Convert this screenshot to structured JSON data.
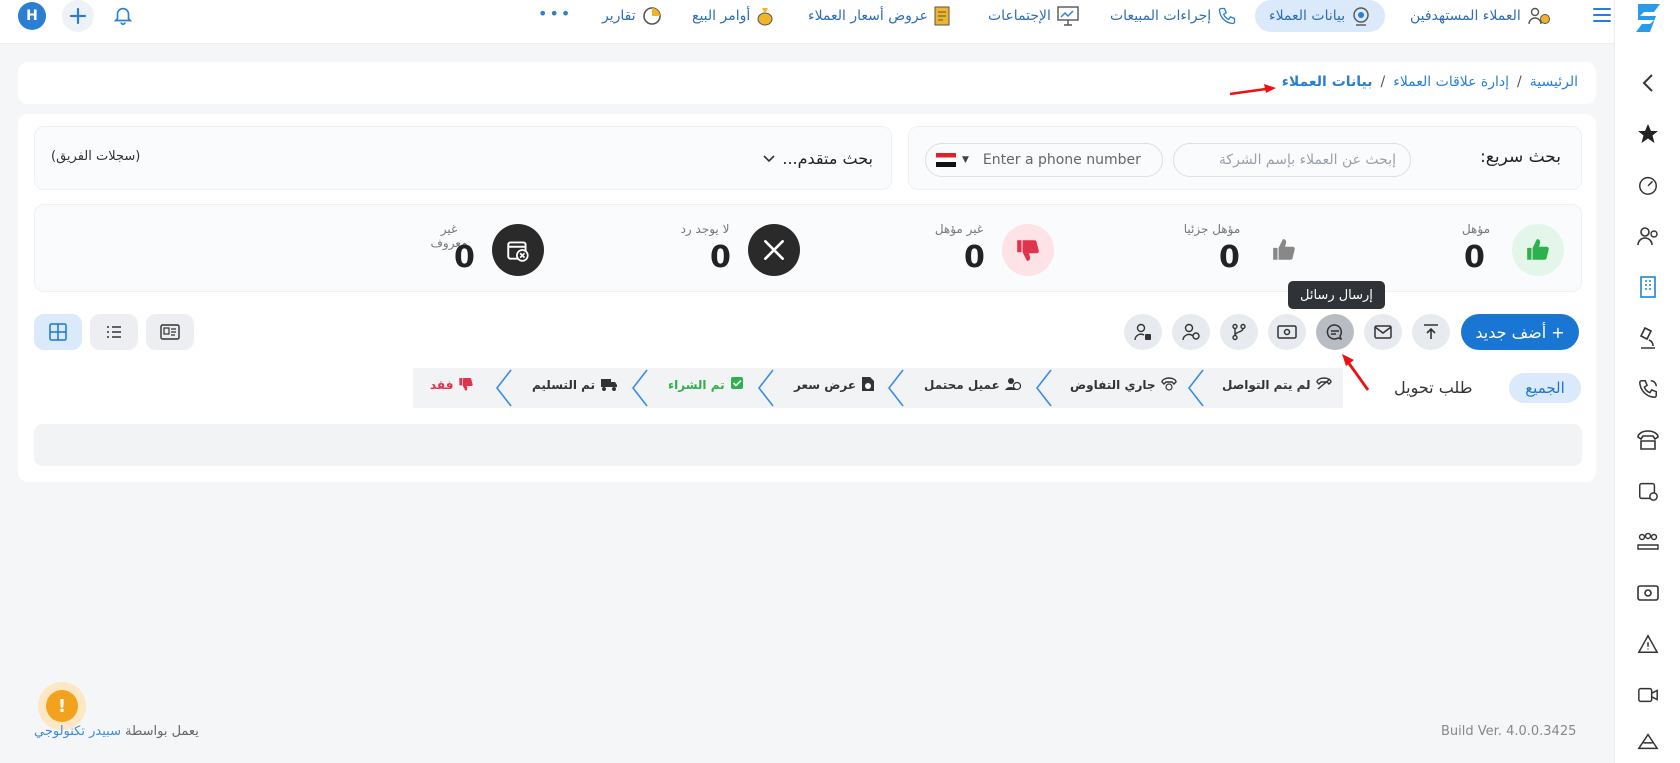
{
  "topnav": {
    "avatar_letter": "H",
    "items": [
      {
        "label": "العملاء المستهدفين"
      },
      {
        "label": "بيانات العملاء"
      },
      {
        "label": "إجراءات المبيعات"
      },
      {
        "label": "الإجتماعات"
      },
      {
        "label": "عروض أسعار العملاء"
      },
      {
        "label": "أوامر البيع"
      },
      {
        "label": "تقارير"
      }
    ],
    "more": "•••"
  },
  "breadcrumb": {
    "home": "الرئيسية",
    "sep1": "/",
    "crm": "إدارة علاقات العملاء",
    "sep2": "/",
    "current": "بيانات العملاء"
  },
  "search": {
    "label": "بحث سريع:",
    "company_placeholder": "إبحث عن العملاء بإسم الشركة",
    "phone_placeholder": "Enter a phone number",
    "advanced": "بحث متقدم...",
    "team_records": "(سجلات الفريق)"
  },
  "stats": [
    {
      "label": "مؤهل",
      "value": "0"
    },
    {
      "label": "مؤهل جزئيا",
      "value": "0"
    },
    {
      "label": "غير مؤهل",
      "value": "0"
    },
    {
      "label": "لا يوجد رد",
      "value": "0"
    },
    {
      "label": "غير معروف",
      "value": "0"
    }
  ],
  "toolbar": {
    "add_new": "+ أضف جديد",
    "tooltip": "إرسال رسائل"
  },
  "stages": {
    "all": "الجميع",
    "conversion": "طلب تحويل",
    "items": [
      {
        "label": "لم يتم التواصل"
      },
      {
        "label": "جاري التفاوض"
      },
      {
        "label": "عميل محتمل"
      },
      {
        "label": "عرض سعر"
      },
      {
        "label": "تم الشراء"
      },
      {
        "label": "تم التسليم"
      },
      {
        "label": "فقد"
      }
    ]
  },
  "footer": {
    "powered_prefix": "يعمل بواسطة",
    "powered_brand": "سبيدر تكنولوجي",
    "build": "Build Ver. 4.0.0.3425",
    "alert": "!"
  },
  "colors": {
    "accent": "#1976d2",
    "qualified": "#2fb04f",
    "unqualified": "#e0334c",
    "dark": "#2a2a2a"
  }
}
